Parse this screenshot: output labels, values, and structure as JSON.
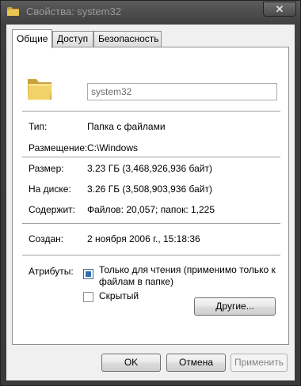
{
  "window": {
    "title": "Свойства: system32",
    "close_glyph": "✕"
  },
  "tabs": [
    {
      "label": "Общие"
    },
    {
      "label": "Доступ"
    },
    {
      "label": "Безопасность"
    }
  ],
  "general": {
    "name_value": "system32",
    "rows": {
      "type": {
        "label": "Тип:",
        "value": "Папка с файлами"
      },
      "location": {
        "label": "Размещение:",
        "value": "C:\\Windows"
      },
      "size": {
        "label": "Размер:",
        "value": "3.23 ГБ (3,468,926,936 байт)"
      },
      "size_on_disk": {
        "label": "На диске:",
        "value": "3.26 ГБ (3,508,903,936 байт)"
      },
      "contains": {
        "label": "Содержит:",
        "value": "Файлов: 20,057; папок: 1,225"
      },
      "created": {
        "label": "Создан:",
        "value": "2 ноября 2006 г., 15:18:36"
      }
    },
    "attributes": {
      "label": "Атрибуты:",
      "readonly_line1": "Только для чтения (применимо только к",
      "readonly_line2": "файлам в папке)",
      "readonly_state": "indeterminate",
      "hidden_label": "Скрытый",
      "hidden_checked": false,
      "advanced_button": "Другие..."
    }
  },
  "buttons": {
    "ok": "OK",
    "cancel": "Отмена",
    "apply": "Применить"
  },
  "icons": {
    "title": "folder-icon",
    "main": "folder-icon"
  },
  "colors": {
    "folder": "#e8c64f",
    "check_fill": "#2f6fb0"
  }
}
